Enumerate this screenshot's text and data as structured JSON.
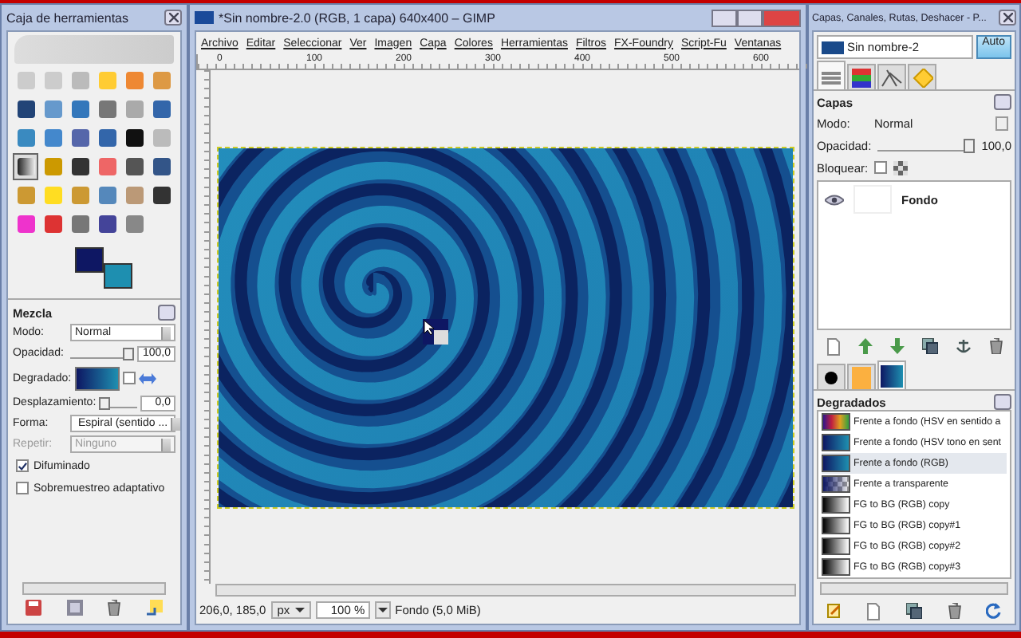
{
  "toolbox": {
    "title": "Caja de herramientas",
    "tools": [
      {
        "selected": false
      },
      {
        "selected": false
      },
      {
        "selected": false
      },
      {
        "selected": false
      },
      {
        "selected": false
      },
      {
        "selected": false
      },
      {
        "selected": false
      },
      {
        "selected": false
      },
      {
        "selected": false
      },
      {
        "selected": false
      },
      {
        "selected": false
      },
      {
        "selected": false
      },
      {
        "selected": false
      },
      {
        "selected": false
      },
      {
        "selected": false
      },
      {
        "selected": false
      },
      {
        "selected": false
      },
      {
        "selected": false
      },
      {
        "selected": true
      },
      {
        "selected": false
      },
      {
        "selected": false
      },
      {
        "selected": false
      },
      {
        "selected": false
      },
      {
        "selected": false
      },
      {
        "selected": false
      },
      {
        "selected": false
      },
      {
        "selected": false
      },
      {
        "selected": false
      },
      {
        "selected": false
      },
      {
        "selected": false
      },
      {
        "selected": false
      },
      {
        "selected": false
      },
      {
        "selected": false
      },
      {
        "selected": false
      },
      {
        "selected": false
      }
    ],
    "options": {
      "title": "Mezcla",
      "fields": [
        {
          "kind": "dropdown",
          "label": "Modo:",
          "value": "Normal",
          "disabled": false
        },
        {
          "kind": "slider",
          "label": "Opacidad:",
          "value": "100,0",
          "level": 1
        },
        {
          "kind": "gradient",
          "label": "Degradado:",
          "reversed": false
        },
        {
          "kind": "slider",
          "label": "Desplazamiento:",
          "value": "0,0",
          "level": 0
        },
        {
          "kind": "dropdown",
          "label": "Forma:",
          "value": "Espiral (sentido ...",
          "disabled": false
        },
        {
          "kind": "dropdown",
          "label": "Repetir:",
          "value": "Ninguno",
          "disabled": true
        }
      ],
      "checks": [
        {
          "label": "Difuminado",
          "checked": true
        },
        {
          "label": "Sobremuestreo adaptativo",
          "checked": false
        }
      ]
    }
  },
  "image_window": {
    "title": "*Sin nombre-2.0 (RGB, 1 capa) 640x400 – GIMP",
    "menu": [
      "Archivo",
      "Editar",
      "Seleccionar",
      "Ver",
      "Imagen",
      "Capa",
      "Colores",
      "Herramientas",
      "Filtros",
      "FX-Foundry",
      "Script-Fu",
      "Ventanas"
    ],
    "ruler": [
      "0",
      "100",
      "200",
      "300",
      "400",
      "500",
      "600"
    ],
    "status": {
      "coordinates": "206,0, 185,0",
      "unit": "px",
      "zoom": "100 %",
      "info": "Fondo (5,0 MiB)"
    }
  },
  "dock": {
    "title": "Capas, Canales, Rutas, Deshacer - P...",
    "image": "Sin nombre-2",
    "auto_button": "Auto",
    "tabs": [
      {
        "kind": "layers",
        "selected": true
      },
      {
        "kind": "channels",
        "selected": false
      },
      {
        "kind": "paths",
        "selected": false
      },
      {
        "kind": "undo",
        "selected": false
      }
    ],
    "layers_panel": {
      "title": "Capas",
      "mode_label": "Modo:",
      "mode": "Normal",
      "opacity_label": "Opacidad:",
      "opacity": "100,0",
      "level": 1,
      "lock_label": "Bloquear:",
      "lock_alpha": false,
      "layers": [
        {
          "name": "Fondo",
          "visible": true
        }
      ]
    },
    "resource_tabs": [
      {
        "kind": "brush",
        "selected": false
      },
      {
        "kind": "pattern",
        "selected": false
      },
      {
        "kind": "gradient",
        "selected": true
      }
    ],
    "gradients_panel": {
      "title": "Degradados",
      "items": [
        {
          "kind": "rainbow",
          "name": "Frente a fondo (HSV en sentido a",
          "selected": false
        },
        {
          "kind": "blue",
          "name": "Frente a fondo (HSV tono en sent",
          "selected": false
        },
        {
          "kind": "blue",
          "name": "Frente a fondo (RGB)",
          "selected": true
        },
        {
          "kind": "transparent",
          "name": "Frente a transparente",
          "selected": false
        },
        {
          "kind": "gray",
          "name": "FG to BG (RGB) copy",
          "selected": false
        },
        {
          "kind": "gray",
          "name": "FG to BG (RGB) copy#1",
          "selected": false
        },
        {
          "kind": "gray",
          "name": "FG to BG (RGB) copy#2",
          "selected": false
        },
        {
          "kind": "gray",
          "name": "FG to BG (RGB) copy#3",
          "selected": false
        }
      ]
    }
  }
}
